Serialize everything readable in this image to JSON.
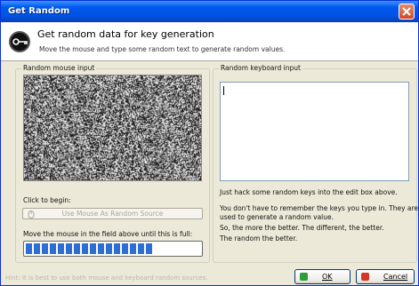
{
  "window": {
    "title": "Get Random"
  },
  "header": {
    "title": "Get random data for key generation",
    "subtitle": "Move the mouse and type some random text to generate random values."
  },
  "mouse_group": {
    "label": "Random mouse input",
    "click_label": "Click to begin:",
    "button_label": "Use Mouse As Random Source",
    "progress_label": "Move the mouse in the field above until this is full:",
    "progress_fraction": 0.75
  },
  "keyboard_group": {
    "label": "Random keyboard input",
    "input_value": "",
    "info_lines": [
      "Just hack some random keys into the edit box above.",
      "You don't have to remember the keys you type in. They are",
      "used to generate a random value.",
      "So, the more the better. The different, the better.",
      "The random the better."
    ]
  },
  "footer": {
    "hint": "Hint: It is best to use both mouse and keyboard random sources.",
    "ok_label": "OK",
    "cancel_label": "Cancel"
  },
  "colors": {
    "progress": "#2c6dd6",
    "title_bar": "#0054e3",
    "ok_icon": "#2f9b3a",
    "cancel_icon": "#d8352a"
  },
  "icons": {
    "header": "key-icon",
    "mouse_button": "mouse-icon",
    "ok": "check-icon",
    "cancel": "x-icon",
    "close": "close-icon"
  }
}
